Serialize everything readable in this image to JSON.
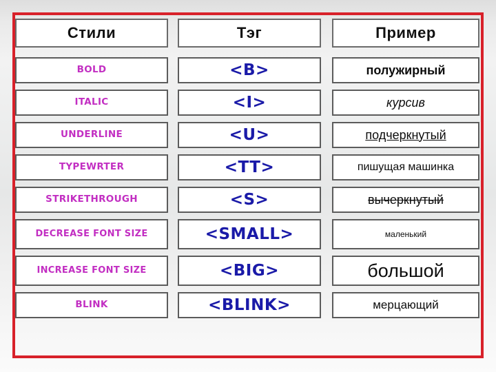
{
  "slide": {
    "frame_color": "#d8212a",
    "style_color": "#c22ec2",
    "tag_color": "#1a1aa8",
    "example_color": "#0d0d0d",
    "cell_border_color": "#5b5b5b"
  },
  "header": {
    "columns": [
      {
        "label": "Стили"
      },
      {
        "label": "Тэг"
      },
      {
        "label": "Пример"
      }
    ]
  },
  "rows": [
    {
      "style": "BOLD",
      "tag": "<B>",
      "example": "полужирный"
    },
    {
      "style": "ITALIC",
      "tag": "<I>",
      "example": "курсив"
    },
    {
      "style": "UNDERLINE",
      "tag": "<U>",
      "example": "подчеркнутый"
    },
    {
      "style": "TYPEWRTER",
      "tag": "<TT>",
      "example": "пишущая машинка"
    },
    {
      "style": "STRIKETHROUGH",
      "tag": "<S>",
      "example": "вычеркнутый"
    },
    {
      "style": "DECREASE FONT SIZE",
      "tag": "<SMALL>",
      "example": "маленький"
    },
    {
      "style": "INCREASE FONT SIZE",
      "tag": "<BIG>",
      "example": "большой"
    },
    {
      "style": "BLINK",
      "tag": "<BLINK>",
      "example": "мерцающий"
    }
  ]
}
